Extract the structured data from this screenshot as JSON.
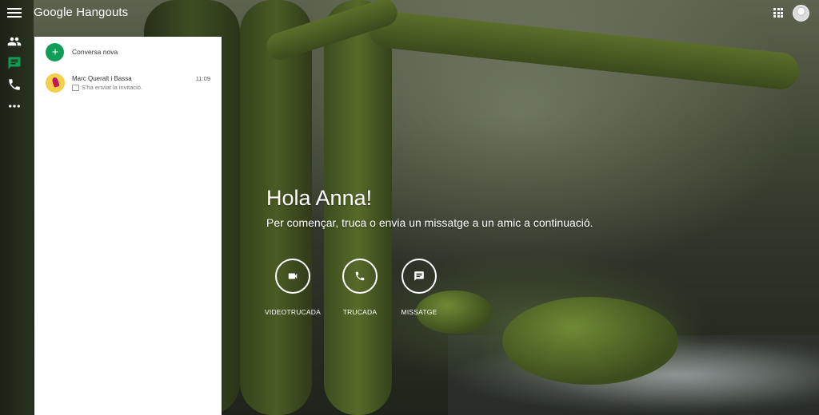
{
  "app": {
    "logo_text": "Google Hangouts"
  },
  "rail": {
    "items": [
      "contacts-icon",
      "messages-icon",
      "phone-icon",
      "more-icon"
    ]
  },
  "panel": {
    "new_conversation_label": "Conversa nova",
    "conversations": [
      {
        "name": "Marc Queralt i Bassa",
        "time": "11:09",
        "preview": "S'ha enviat la invitació."
      }
    ]
  },
  "main": {
    "greeting": "Hola Anna!",
    "subtitle": "Per començar, truca o envia un missatge a un amic a continuació.",
    "actions": [
      {
        "label": "VIDEOTRUCADA",
        "icon": "videocam-icon"
      },
      {
        "label": "TRUCADA",
        "icon": "phone-icon"
      },
      {
        "label": "MISSATGE",
        "icon": "chat-icon"
      }
    ]
  },
  "colors": {
    "accent_green": "#0f9d58",
    "active_rail_icon": "#0f9d58"
  }
}
